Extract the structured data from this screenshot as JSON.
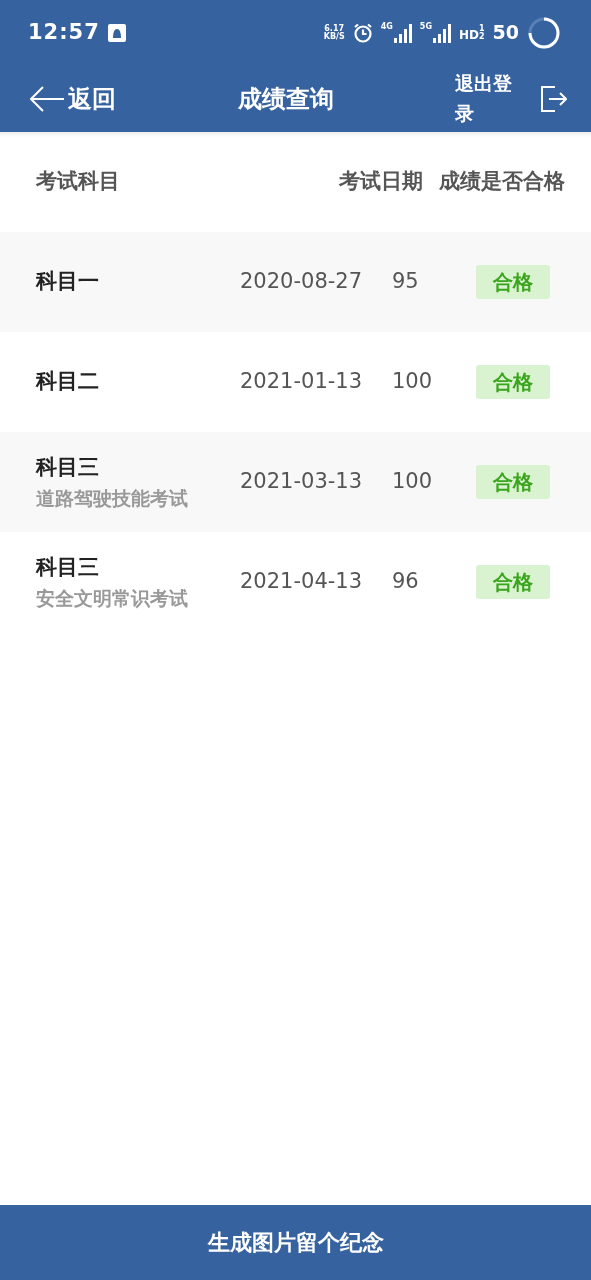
{
  "status_bar": {
    "time": "12:57",
    "speed_value": "6.17",
    "speed_unit": "KB/S",
    "net_1": "4G",
    "net_2": "5G",
    "hd": "HD",
    "sim_1": "1",
    "sim_2": "2",
    "battery": "50"
  },
  "nav": {
    "back": "返回",
    "title": "成绩查询",
    "logout": "退出登录"
  },
  "table": {
    "columns": [
      "考试科目",
      "考试日期",
      "成绩是否合格"
    ],
    "rows": [
      {
        "subject": "科目一",
        "date": "2020-08-27",
        "score": "95",
        "result": "合格",
        "passed": true
      },
      {
        "subject": "科目二",
        "date": "2021-01-13",
        "score": "100",
        "result": "合格",
        "passed": true
      },
      {
        "subject": "科目三",
        "subtitle": "道路驾驶技能考试",
        "date": "2021-03-13",
        "score": "100",
        "result": "合格",
        "passed": true
      },
      {
        "subject": "科目三",
        "subtitle": "安全文明常识考试",
        "date": "2021-04-13",
        "score": "96",
        "result": "合格",
        "passed": true
      }
    ]
  },
  "footer_button": "生成图片留个纪念"
}
